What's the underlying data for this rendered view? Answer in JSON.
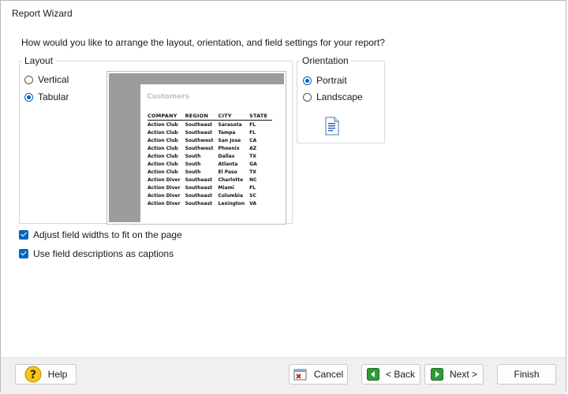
{
  "window": {
    "title": "Report Wizard"
  },
  "question": "How would you like to arrange the layout, orientation, and field settings for your report?",
  "layout": {
    "legend": "Layout",
    "options": [
      {
        "label": "Vertical",
        "selected": false
      },
      {
        "label": "Tabular",
        "selected": true
      }
    ]
  },
  "preview": {
    "title": "Customers",
    "columns": [
      "COMPANY",
      "REGION",
      "CITY",
      "STATE"
    ],
    "rows": [
      [
        "Action Club",
        "Southeast",
        "Sarasota",
        "FL"
      ],
      [
        "Action Club",
        "Southeast",
        "Tampa",
        "FL"
      ],
      [
        "Action Club",
        "Southwest",
        "San Jose",
        "CA"
      ],
      [
        "Action Club",
        "Southwest",
        "Phoenix",
        "AZ"
      ],
      [
        "Action Club",
        "South",
        "Dallas",
        "TX"
      ],
      [
        "Action Club",
        "South",
        "Atlanta",
        "GA"
      ],
      [
        "Action Club",
        "South",
        "El Paso",
        "TX"
      ],
      [
        "Action Diver",
        "Southeast",
        "Charlotte",
        "NC"
      ],
      [
        "Action Diver",
        "Southeast",
        "Miami",
        "FL"
      ],
      [
        "Action Diver",
        "Southeast",
        "Columbia",
        "SC"
      ],
      [
        "Action Diver",
        "Southeast",
        "Lexington",
        "VA"
      ]
    ]
  },
  "orientation": {
    "legend": "Orientation",
    "options": [
      {
        "label": "Portrait",
        "selected": true
      },
      {
        "label": "Landscape",
        "selected": false
      }
    ],
    "icon": "portrait-page-icon"
  },
  "options": {
    "adjust_widths": {
      "label": "Adjust field widths to fit on the page",
      "checked": true
    },
    "use_descriptions": {
      "label": "Use field descriptions as captions",
      "checked": true
    }
  },
  "buttons": {
    "help": "Help",
    "cancel": "Cancel",
    "back": "< Back",
    "next": "Next >",
    "finish": "Finish"
  },
  "colors": {
    "accent": "#0067c0",
    "footer_bg": "#f0f0f0",
    "preview_bg": "#9c9c9c"
  }
}
